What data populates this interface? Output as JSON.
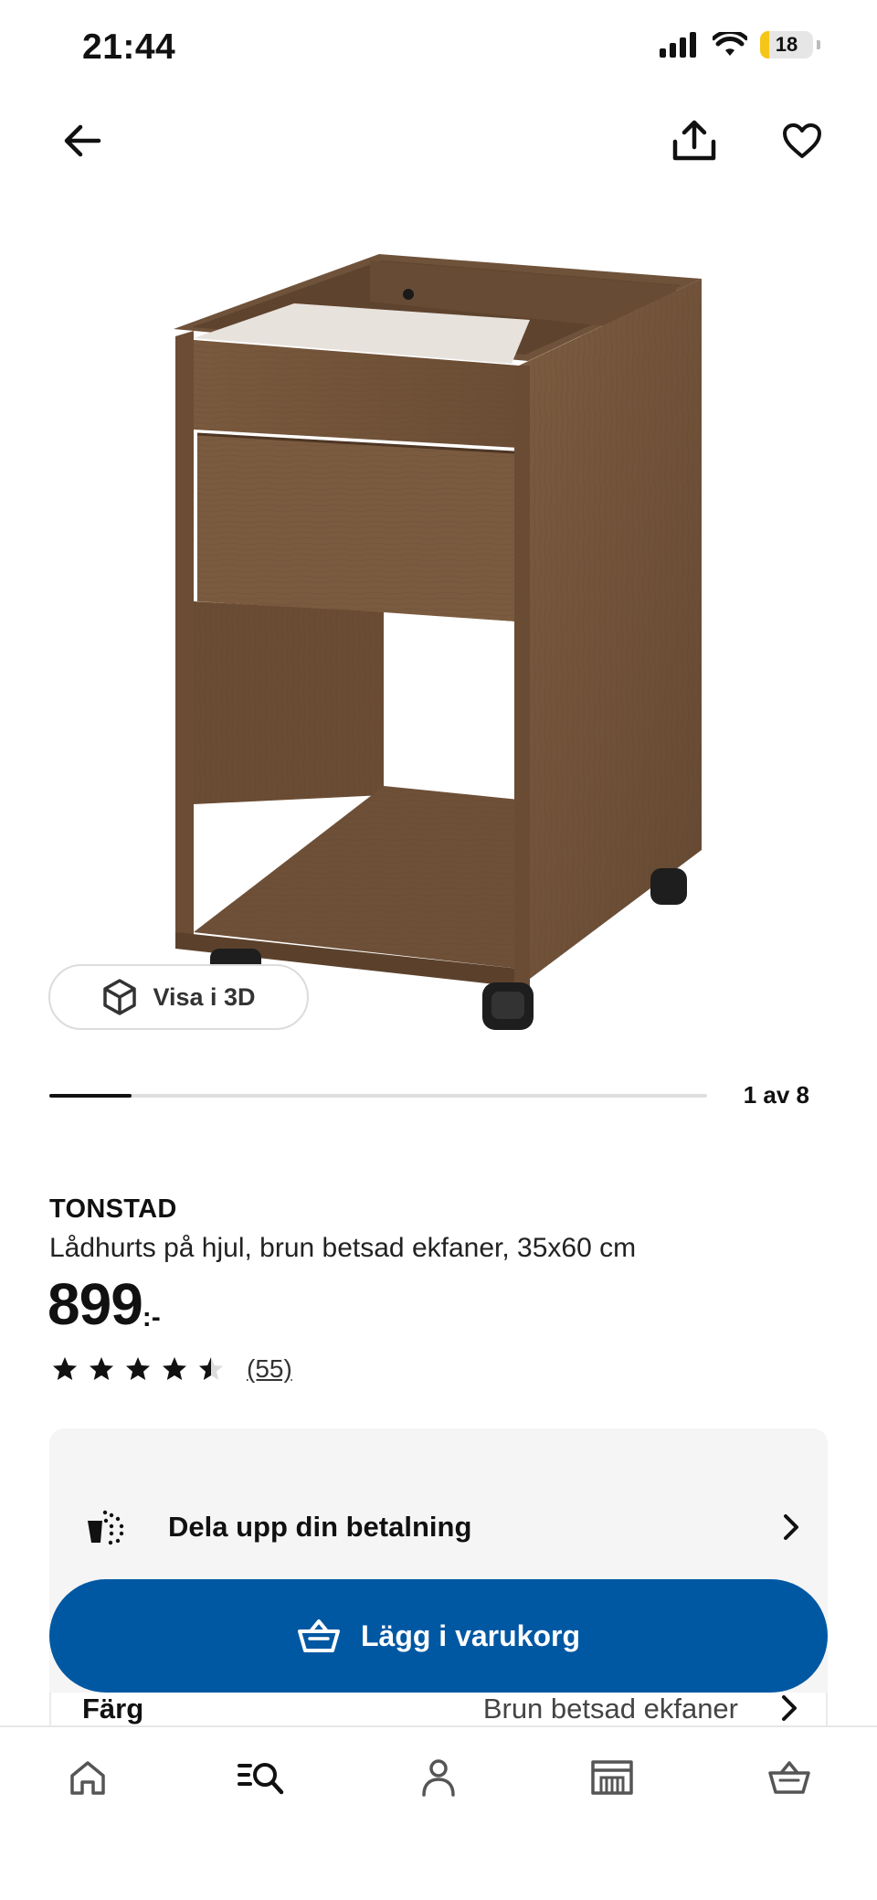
{
  "status_bar": {
    "time": "21:44",
    "battery_level": "18",
    "battery_fraction": 0.18
  },
  "nav": {
    "back_icon": "arrow-left-icon",
    "share_icon": "share-icon",
    "favorite_icon": "heart-icon"
  },
  "gallery": {
    "view_3d_label": "Visa i 3D",
    "counter": "1 av 8",
    "current_image": 1,
    "total_images": 8
  },
  "product": {
    "brand": "TONSTAD",
    "description": "Lådhurts på hjul, brun betsad ekfaner, 35x60 cm",
    "price": "899",
    "price_suffix": ":-",
    "rating": 4.5,
    "rating_max": 5,
    "review_count": "(55)"
  },
  "payment": {
    "label": "Dela upp din betalning"
  },
  "cart_button": {
    "label": "Lägg i varukorg"
  },
  "color": {
    "label": "Färg",
    "value": "Brun betsad ekfaner"
  },
  "tabs": [
    {
      "icon": "home-icon"
    },
    {
      "icon": "search-icon"
    },
    {
      "icon": "profile-icon"
    },
    {
      "icon": "store-icon"
    },
    {
      "icon": "cart-icon"
    }
  ],
  "colors": {
    "accent": "#0058a3",
    "battery": "#f5c518"
  }
}
